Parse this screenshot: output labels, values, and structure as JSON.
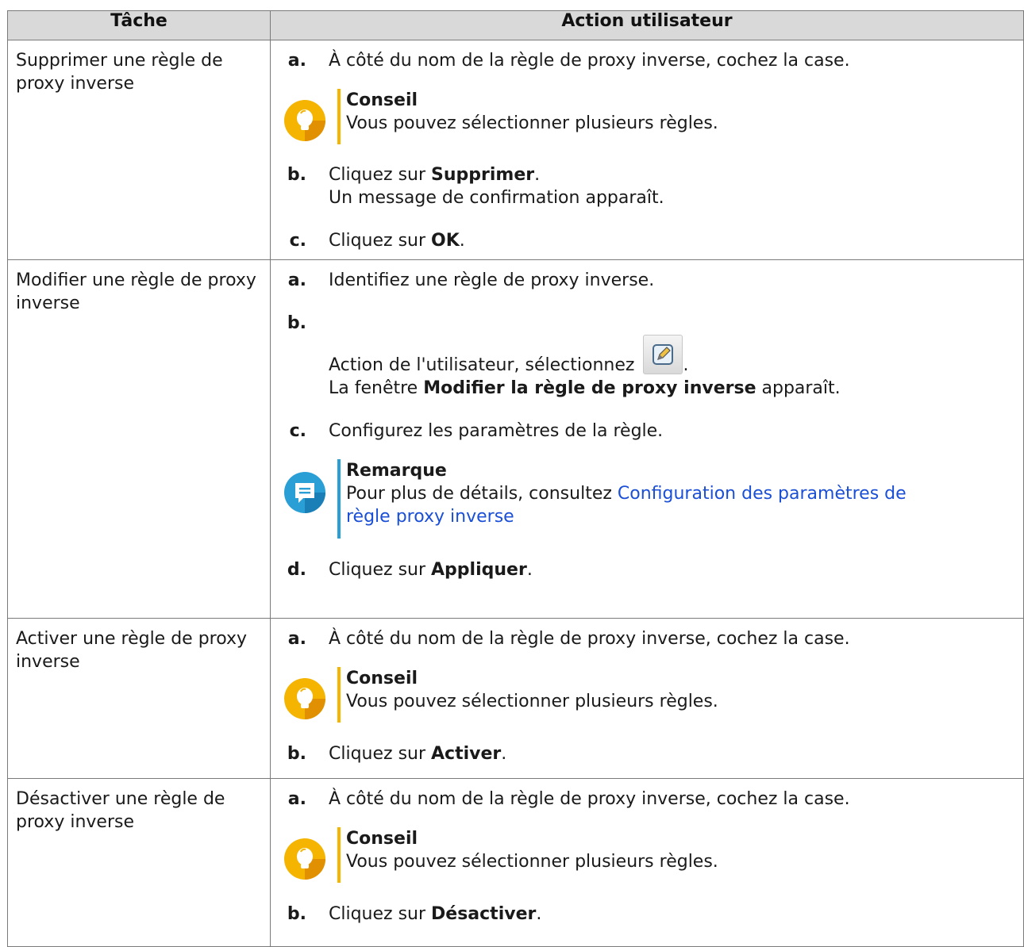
{
  "table": {
    "header": {
      "task": "Tâche",
      "action": "Action utilisateur"
    },
    "rows": [
      {
        "task": "Supprimer une règle de proxy inverse",
        "steps": [
          {
            "letter": "a.",
            "text": "À côté du nom de la règle de proxy inverse, cochez la case."
          },
          {
            "letter": "b.",
            "pre": "Cliquez sur ",
            "bold": "Supprimer",
            "post": ".",
            "line2": "Un message de confirmation apparaît."
          },
          {
            "letter": "c.",
            "pre": "Cliquez sur ",
            "bold": "OK",
            "post": "."
          }
        ],
        "callout": {
          "title": "Conseil",
          "text": "Vous pouvez sélectionner plusieurs règles."
        }
      },
      {
        "task": "Modifier une règle de proxy inverse",
        "steps": [
          {
            "letter": "a.",
            "text": "Identifiez une règle de proxy inverse."
          },
          {
            "letter": "b.",
            "line1": "Action de l'utilisateur, sélectionnez ",
            "line1_post": ".",
            "pre": "La fenêtre ",
            "bold": "Modifier la règle de proxy inverse",
            "post": " apparaît."
          },
          {
            "letter": "c.",
            "text": "Configurez les paramètres de la règle."
          },
          {
            "letter": "d.",
            "pre": "Cliquez sur ",
            "bold": "Appliquer",
            "post": "."
          }
        ],
        "callout": {
          "title": "Remarque",
          "text": "Pour plus de détails, consultez ",
          "link": "Configuration des paramètres de règle proxy inverse"
        }
      },
      {
        "task": "Activer une règle de proxy inverse",
        "steps": [
          {
            "letter": "a.",
            "text": "À côté du nom de la règle de proxy inverse, cochez la case."
          },
          {
            "letter": "b.",
            "pre": "Cliquez sur ",
            "bold": "Activer",
            "post": "."
          }
        ],
        "callout": {
          "title": "Conseil",
          "text": "Vous pouvez sélectionner plusieurs règles."
        }
      },
      {
        "task": "Désactiver une règle de proxy inverse",
        "steps": [
          {
            "letter": "a.",
            "text": "À côté du nom de la règle de proxy inverse, cochez la case."
          },
          {
            "letter": "b.",
            "pre": "Cliquez sur ",
            "bold": "Désactiver",
            "post": "."
          }
        ],
        "callout": {
          "title": "Conseil",
          "text": "Vous pouvez sélectionner plusieurs règles."
        }
      }
    ]
  },
  "colors": {
    "header_bg": "#d9d9d9",
    "tip_accent": "#f4b400",
    "note_accent": "#2a9fd6",
    "link": "#1a4fd6"
  },
  "icons": {
    "tip": "lightbulb-icon",
    "note": "note-icon",
    "edit": "edit-icon"
  }
}
